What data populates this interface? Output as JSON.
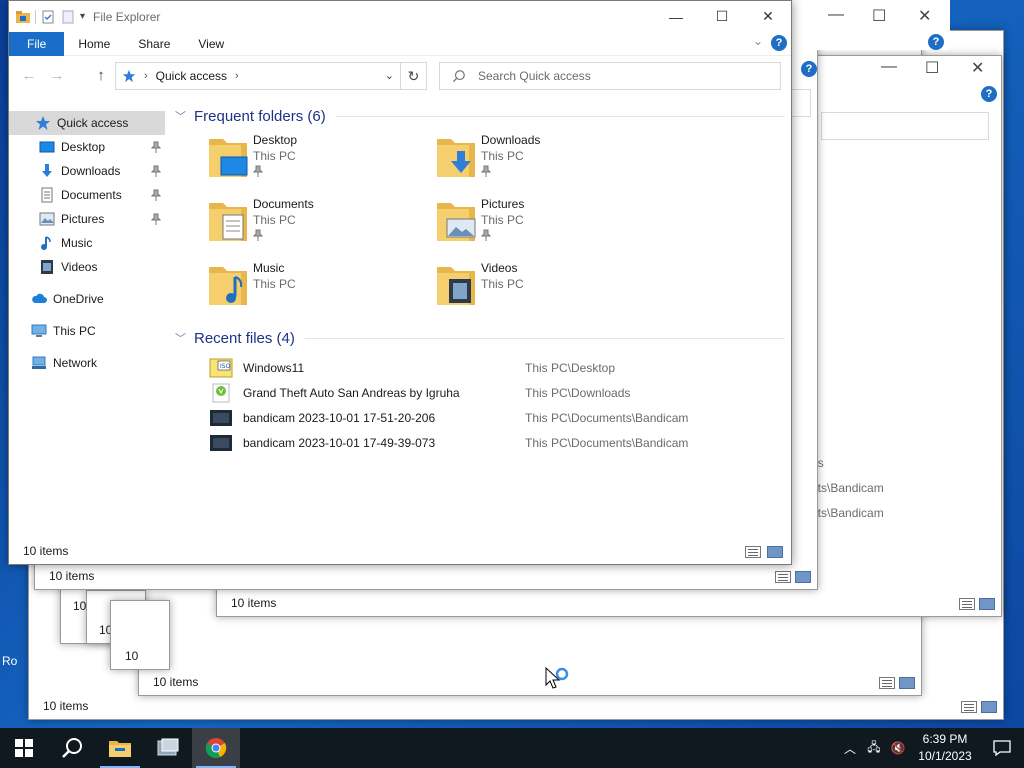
{
  "window": {
    "title": "File Explorer",
    "tabs": {
      "file": "File",
      "home": "Home",
      "share": "Share",
      "view": "View"
    },
    "help_label": "?",
    "minimize_icon": "—",
    "maximize_icon": "☐",
    "close_icon": "✕"
  },
  "nav": {
    "breadcrumb": "Quick access",
    "search_placeholder": "Search Quick access"
  },
  "sidebar": {
    "items": [
      {
        "label": "Quick access",
        "icon": "star-icon"
      },
      {
        "label": "Desktop",
        "icon": "desktop-icon",
        "pinned": true
      },
      {
        "label": "Downloads",
        "icon": "download-icon",
        "pinned": true
      },
      {
        "label": "Documents",
        "icon": "document-icon",
        "pinned": true
      },
      {
        "label": "Pictures",
        "icon": "pictures-icon",
        "pinned": true
      },
      {
        "label": "Music",
        "icon": "music-icon"
      },
      {
        "label": "Videos",
        "icon": "videos-icon"
      },
      {
        "label": "OneDrive",
        "icon": "cloud-icon"
      },
      {
        "label": "This PC",
        "icon": "computer-icon"
      },
      {
        "label": "Network",
        "icon": "network-icon"
      }
    ]
  },
  "frequent": {
    "header": "Frequent folders (6)",
    "folders": [
      {
        "name": "Desktop",
        "location": "This PC",
        "pinned": true
      },
      {
        "name": "Downloads",
        "location": "This PC",
        "pinned": true
      },
      {
        "name": "Documents",
        "location": "This PC",
        "pinned": true
      },
      {
        "name": "Pictures",
        "location": "This PC",
        "pinned": true
      },
      {
        "name": "Music",
        "location": "This PC"
      },
      {
        "name": "Videos",
        "location": "This PC"
      }
    ]
  },
  "recent": {
    "header": "Recent files (4)",
    "files": [
      {
        "name": "Windows11",
        "path": "This PC\\Desktop",
        "icon": "iso-file-icon"
      },
      {
        "name": "Grand Theft Auto San Andreas by Igruha",
        "path": "This PC\\Downloads",
        "icon": "torrent-file-icon"
      },
      {
        "name": "bandicam 2023-10-01 17-51-20-206",
        "path": "This PC\\Documents\\Bandicam",
        "icon": "video-file-icon"
      },
      {
        "name": "bandicam 2023-10-01 17-49-39-073",
        "path": "This PC\\Documents\\Bandicam",
        "icon": "video-file-icon"
      }
    ]
  },
  "status": {
    "items": "10 items"
  },
  "background_windows": {
    "status": "10 items",
    "partial_paths": [
      "ds",
      "nts\\Bandicam",
      "nts\\Bandicam"
    ],
    "partial_counts": [
      "10",
      "10",
      "10"
    ]
  },
  "desktop": {
    "partial_label": "Ro"
  },
  "taskbar": {
    "time": "6:39 PM",
    "date": "10/1/2023"
  },
  "colors": {
    "accent": "#1a6ec9",
    "header_text": "#1e3287",
    "taskbar": "#101820"
  }
}
